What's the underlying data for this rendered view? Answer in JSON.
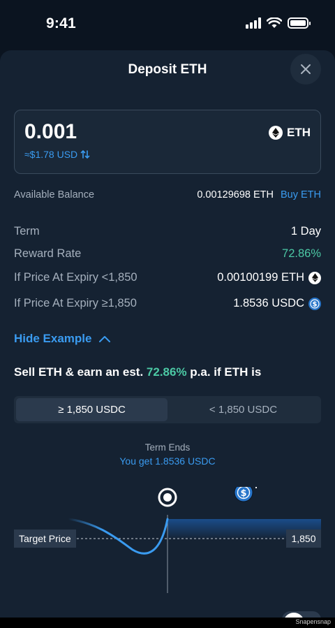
{
  "status": {
    "time": "9:41"
  },
  "sheet": {
    "title": "Deposit ETH"
  },
  "amount": {
    "value": "0.001",
    "usd": "≈$1.78 USD",
    "asset": "ETH"
  },
  "balance": {
    "label": "Available Balance",
    "value": "0.00129698 ETH",
    "buy_label": "Buy ETH"
  },
  "details": [
    {
      "label": "Term",
      "value": "1 Day"
    },
    {
      "label": "Reward Rate",
      "value": "72.86%"
    },
    {
      "label": "If Price At Expiry <1,850",
      "value": "0.00100199 ETH",
      "icon": "eth-icon"
    },
    {
      "label": "If Price At Expiry ≥1,850",
      "value": "1.8536 USDC",
      "icon": "usdc-icon"
    }
  ],
  "example": {
    "toggle_label": "Hide Example",
    "headline_prefix": "Sell ETH & earn an est. ",
    "headline_rate": "72.86%",
    "headline_suffix": " p.a. if ETH is"
  },
  "segments": {
    "items": [
      "≥ 1,850 USDC",
      "< 1,850 USDC"
    ],
    "selected": 0
  },
  "outcome": {
    "term_label": "Term Ends",
    "result": "You get 1.8536 USDC"
  },
  "chart": {
    "target_label": "Target Price",
    "target_value": "1,850"
  },
  "watermark": "Snapensnap",
  "colors": {
    "accent": "#3a9bf0",
    "positive": "#4cc9a5",
    "sheet_bg": "#152232",
    "page_bg": "#0b1420"
  }
}
